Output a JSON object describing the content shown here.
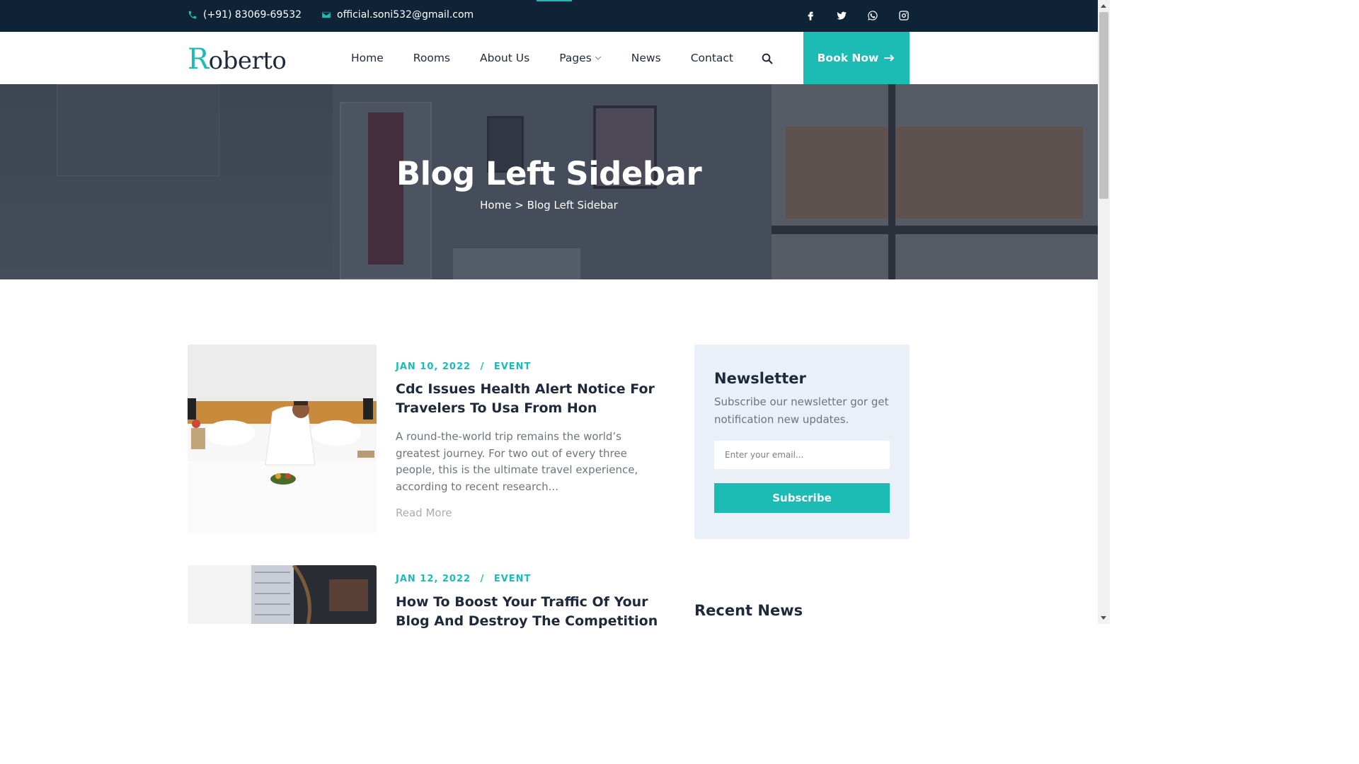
{
  "topbar": {
    "phone": "(+91) 83069-69532",
    "email": "official.soni532@gmail.com",
    "socials": [
      "facebook-icon",
      "twitter-icon",
      "whatsapp-icon",
      "instagram-icon"
    ]
  },
  "header": {
    "logo_first": "R",
    "logo_rest": "oberto",
    "nav": [
      {
        "label": "Home"
      },
      {
        "label": "Rooms"
      },
      {
        "label": "About Us"
      },
      {
        "label": "Pages",
        "has_dropdown": true
      },
      {
        "label": "News"
      },
      {
        "label": "Contact"
      }
    ],
    "book_label": "Book Now"
  },
  "hero": {
    "title": "Blog Left Sidebar",
    "breadcrumb_home": "Home",
    "breadcrumb_sep": ">",
    "breadcrumb_current": "Blog Left Sidebar"
  },
  "posts": [
    {
      "date": "JAN 10, 2022",
      "separator": "/",
      "category": "EVENT",
      "title": "Cdc Issues Health Alert Notice For Travelers To Usa From Hon",
      "excerpt": "A round-the-world trip remains the world’s greatest journey. For two out of every three people, this is the ultimate travel experience, according to recent research...",
      "read_more": "Read More"
    },
    {
      "date": "JAN 12, 2022",
      "separator": "/",
      "category": "EVENT",
      "title": "How To Boost Your Traffic Of Your Blog And Destroy The Competition"
    }
  ],
  "sidebar": {
    "newsletter": {
      "title": "Newsletter",
      "description": "Subscribe our newsletter gor get notification new updates.",
      "placeholder": "Enter your email...",
      "button": "Subscribe"
    },
    "recent_news_title": "Recent News"
  },
  "colors": {
    "accent": "#1cbbb4",
    "topbar_bg": "#0f2336",
    "text_dark": "#1e2a3b",
    "newsletter_bg": "#eaf0f7"
  }
}
